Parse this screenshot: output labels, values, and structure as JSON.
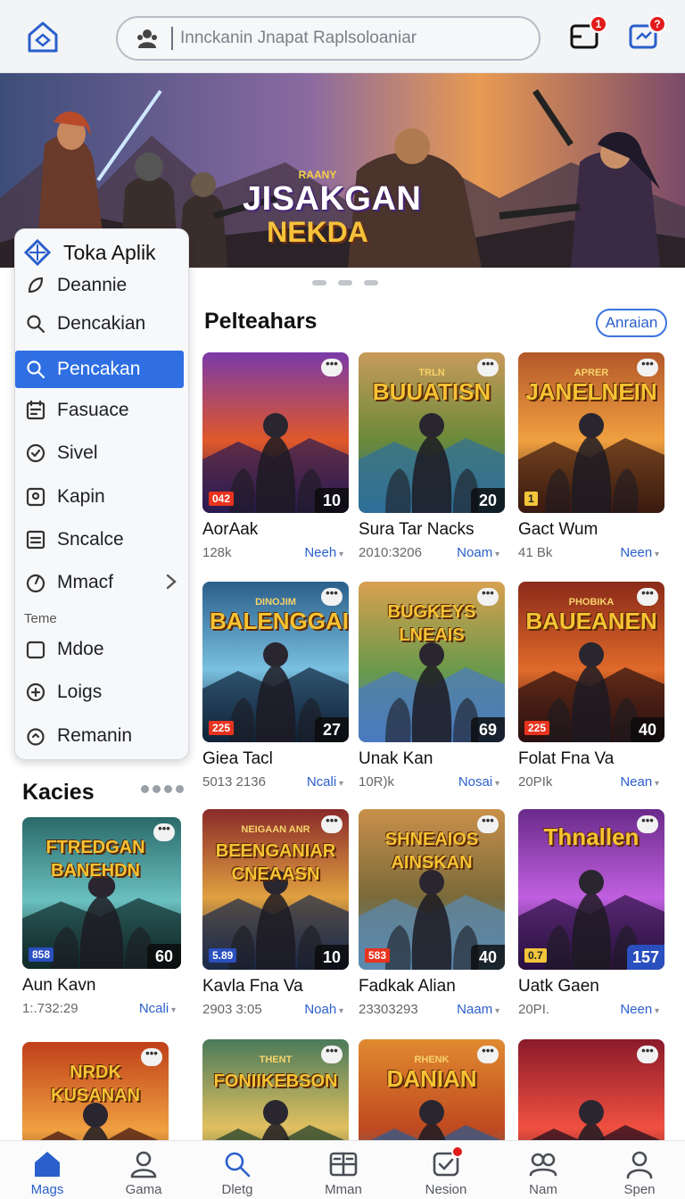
{
  "header": {
    "search_placeholder": "Innckanin Jnapat Raplsoloaniar",
    "messages_badge": "1",
    "notifications_badge": "?"
  },
  "banner": {
    "small_text": "RAANY",
    "title": "JISAKGAN",
    "subtitle": "NEKDA",
    "dots": 3
  },
  "drawer": {
    "title": "Toka Aplik",
    "items": [
      {
        "label": "Deannie",
        "icon": "leaf-icon"
      },
      {
        "label": "Dencakian",
        "icon": "search-icon"
      },
      {
        "label": "Pencakan",
        "icon": "search-icon",
        "active": true
      },
      {
        "label": "Fasuace",
        "icon": "calendar-icon"
      },
      {
        "label": "Sivel",
        "icon": "check-circle-icon"
      },
      {
        "label": "Kapin",
        "icon": "location-icon"
      },
      {
        "label": "Sncalce",
        "icon": "list-icon"
      },
      {
        "label": "Mmacf",
        "icon": "gauge-icon",
        "has_chevron": true
      }
    ],
    "section_label": "Teme",
    "section_items": [
      {
        "label": "Mdoe",
        "icon": "square-icon"
      },
      {
        "label": "Loigs",
        "icon": "plus-circle-icon"
      },
      {
        "label": "Remanin",
        "icon": "timer-icon"
      }
    ]
  },
  "sections": {
    "featured_title": "Pelteahars",
    "featured_button": "Anraian",
    "category_title": "Kacies"
  },
  "cards": [
    {
      "art_small": "",
      "art_title": "",
      "tag": "042",
      "tag_style": "red",
      "num": "10",
      "name": "AorAak",
      "stat": "128k",
      "action": "Neeh"
    },
    {
      "art_small": "TRLN",
      "art_title": "BUUATISN",
      "tag": "",
      "tag_style": "",
      "num": "20",
      "name": "Sura Tar Nacks",
      "stat": "2010:3206",
      "action": "Noam"
    },
    {
      "art_small": "APRER",
      "art_title": "JANELNEIN",
      "tag": "1",
      "tag_style": "yellow",
      "num": "",
      "name": "Gact Wum",
      "stat": "41 Bk",
      "action": "Neen"
    },
    {
      "art_small": "DINOJIM",
      "art_title": "BALENGGAI",
      "tag": "225",
      "tag_style": "red",
      "num": "27",
      "name": "Giea Tacl",
      "stat": "5013 2136",
      "action": "Ncali"
    },
    {
      "art_small": "",
      "art_title": "BUGKEYS LNEAIS",
      "tag": "",
      "tag_style": "",
      "num": "69",
      "name": "Unak Kan",
      "stat": "10R)k",
      "action": "Nosai"
    },
    {
      "art_small": "PHOBIKA",
      "art_title": "BAUEANEN",
      "tag": "225",
      "tag_style": "red",
      "num": "40",
      "name": "Folat Fna Va",
      "stat": "20PIk",
      "action": "Nean"
    },
    {
      "art_small": "",
      "art_title": "FTREDGAN BANEHDN",
      "tag": "858",
      "tag_style": "blue",
      "num": "60",
      "name": "Aun Kavn",
      "stat": "1:.732:29",
      "action": "Ncali"
    },
    {
      "art_small": "NEIGAAN ANR",
      "art_title": "BEENGANIAR CNEAASN",
      "tag": "5.89",
      "tag_style": "blue",
      "num": "10",
      "name": "Kavla Fna Va",
      "stat": "2903 3:05",
      "action": "Noah"
    },
    {
      "art_small": "",
      "art_title": "SHNEAIOS AINSKAN",
      "tag": "583",
      "tag_style": "red",
      "num": "40",
      "name": "Fadkak Alian",
      "stat": "23303293",
      "action": "Naam"
    },
    {
      "art_small": "",
      "art_title": "Thnallen",
      "tag": "0.7",
      "tag_style": "yellow",
      "num": "157",
      "num_style": "blue",
      "name": "Uatk Gaen",
      "stat": "20PI.",
      "action": "Neen"
    },
    {
      "art_small": "",
      "art_title": "NRDK KUSANAN",
      "tag": "",
      "tag_style": "",
      "num": "",
      "name": "",
      "stat": "",
      "action": ""
    },
    {
      "art_small": "THENT",
      "art_title": "FONIIKEBSON",
      "tag": "",
      "tag_style": "",
      "num": "",
      "name": "",
      "stat": "",
      "action": ""
    },
    {
      "art_small": "RHENK",
      "art_title": "DANIAN",
      "tag": "",
      "tag_style": "",
      "num": "",
      "name": "",
      "stat": "",
      "action": ""
    },
    {
      "art_small": "",
      "art_title": "",
      "tag": "",
      "tag_style": "",
      "num": "",
      "name": "",
      "stat": "",
      "action": ""
    }
  ],
  "bottom_nav": [
    {
      "label": "Mags",
      "icon": "home-icon",
      "active": true
    },
    {
      "label": "Gama",
      "icon": "user-icon"
    },
    {
      "label": "Dletg",
      "icon": "search-icon"
    },
    {
      "label": "Mman",
      "icon": "grid-icon"
    },
    {
      "label": "Nesion",
      "icon": "badge-icon",
      "badge": true
    },
    {
      "label": "Nam",
      "icon": "people-icon"
    },
    {
      "label": "Spen",
      "icon": "profile-icon"
    }
  ],
  "colors": {
    "accent": "#2f6fe3",
    "badge": "#e21b1b",
    "link": "#2a5fcc"
  }
}
